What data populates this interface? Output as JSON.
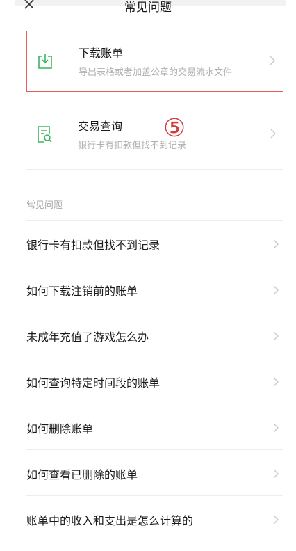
{
  "header": {
    "title": "常见问题"
  },
  "cards": [
    {
      "title": "下载账单",
      "subtitle": "导出表格或者加盖公章的交易流水文件",
      "icon": "download-icon"
    },
    {
      "title": "交易查询",
      "subtitle": "银行卡有扣款但找不到记录",
      "icon": "search-document-icon"
    }
  ],
  "annotation": {
    "step": "⑤"
  },
  "faq": {
    "section_title": "常见问题",
    "items": [
      "银行卡有扣款但找不到记录",
      "如何下载注销前的账单",
      "未成年充值了游戏怎么办",
      "如何查询特定时间段的账单",
      "如何删除账单",
      "如何查看已删除的账单",
      "账单中的收入和支出是怎么计算的"
    ]
  },
  "colors": {
    "accent_green": "#3bb562",
    "highlight_red": "#e35b5b",
    "annotation_red": "#d43b3b",
    "secondary_text": "#b0b0b0"
  }
}
